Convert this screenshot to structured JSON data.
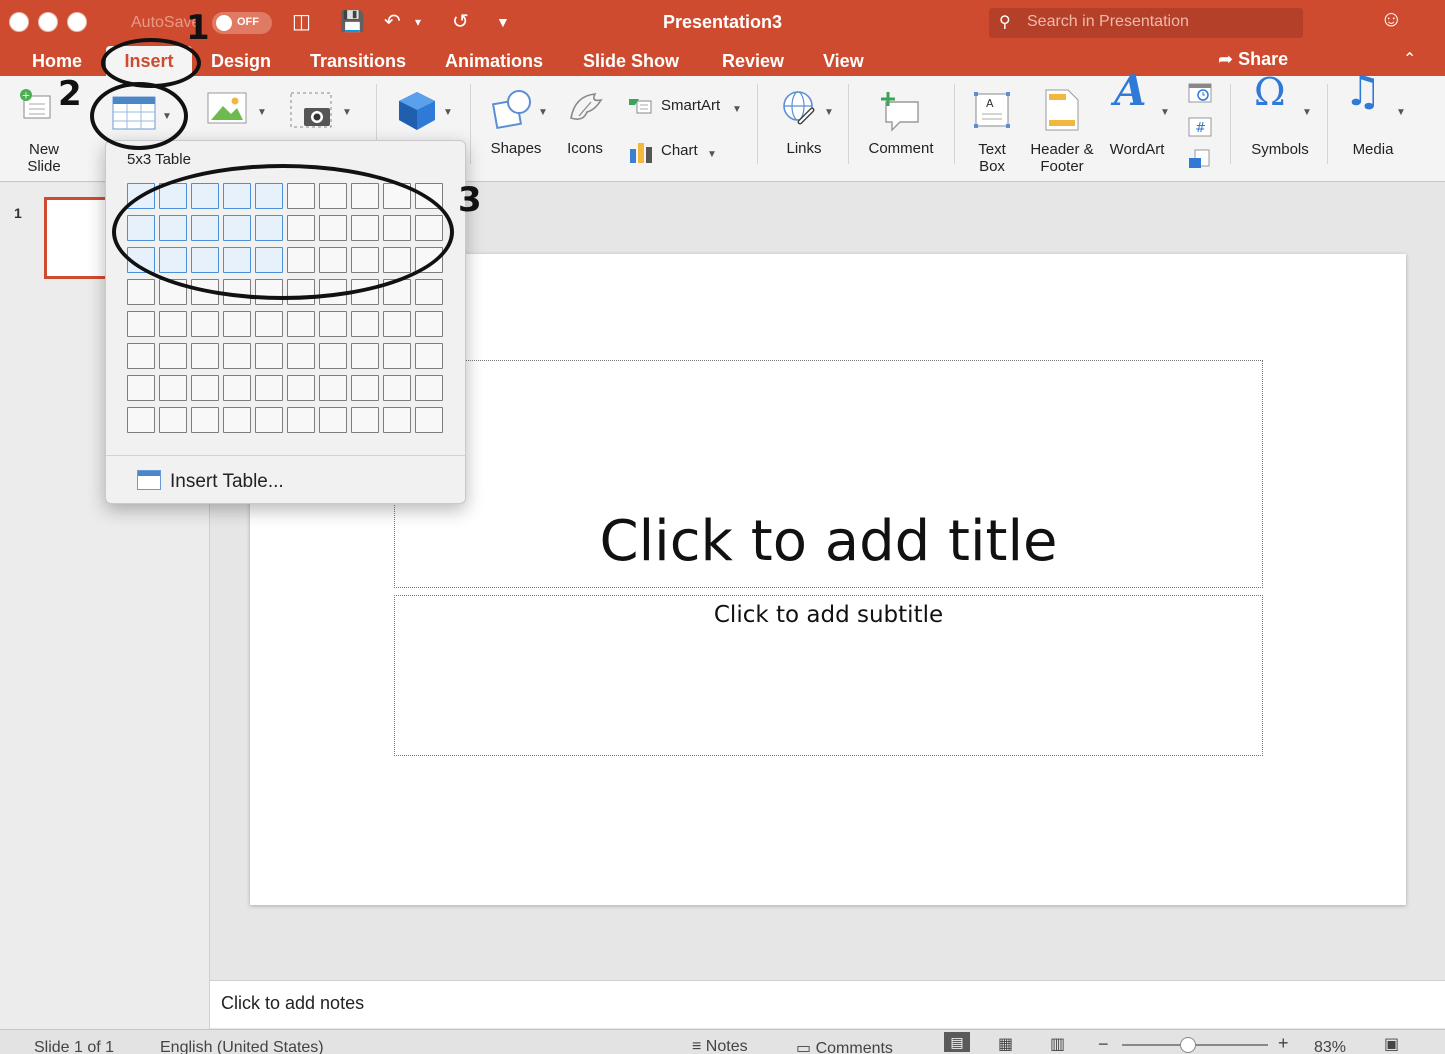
{
  "titlebar": {
    "autosave_label": "AutoSave",
    "autosave_state": "OFF",
    "document_title": "Presentation3",
    "search_placeholder": "Search in Presentation",
    "icons": [
      "sidebar-icon",
      "save-icon",
      "undo-icon",
      "redo-icon",
      "customize-icon",
      "smiley-icon"
    ]
  },
  "tabs": {
    "home": "Home",
    "insert": "Insert",
    "design": "Design",
    "transitions": "Transitions",
    "animations": "Animations",
    "slide_show": "Slide Show",
    "review": "Review",
    "view": "View",
    "share": "Share",
    "active": "Insert"
  },
  "ribbon": {
    "new_slide_line1": "New",
    "new_slide_line2": "Slide",
    "shapes": "Shapes",
    "icons": "Icons",
    "smartart": "SmartArt",
    "chart": "Chart",
    "links": "Links",
    "comment": "Comment",
    "text_box_line1": "Text",
    "text_box_line2": "Box",
    "header_footer_line1": "Header &",
    "header_footer_line2": "Footer",
    "wordart": "WordArt",
    "symbols": "Symbols",
    "media": "Media"
  },
  "table_dropdown": {
    "caption": "5x3 Table",
    "columns": 10,
    "rows": 8,
    "selected_columns": 5,
    "selected_rows": 3,
    "insert_table_label": "Insert Table..."
  },
  "thumbnails": {
    "slide_number": "1"
  },
  "slide": {
    "title_placeholder": "Click to add title",
    "subtitle_placeholder": "Click to add subtitle"
  },
  "notes": {
    "placeholder": "Click to add notes"
  },
  "statusbar": {
    "slide_position": "Slide 1 of 1",
    "language": "English (United States)",
    "notes": "Notes",
    "comments": "Comments",
    "zoom": "83%",
    "zoom_level": 0.83
  },
  "annotations": {
    "step1": "1",
    "step2": "2",
    "step3": "3"
  },
  "colors": {
    "accent": "#cf4b2f",
    "grid_selected_border": "#4a90d9",
    "grid_selected_fill": "#e6f1fc"
  }
}
